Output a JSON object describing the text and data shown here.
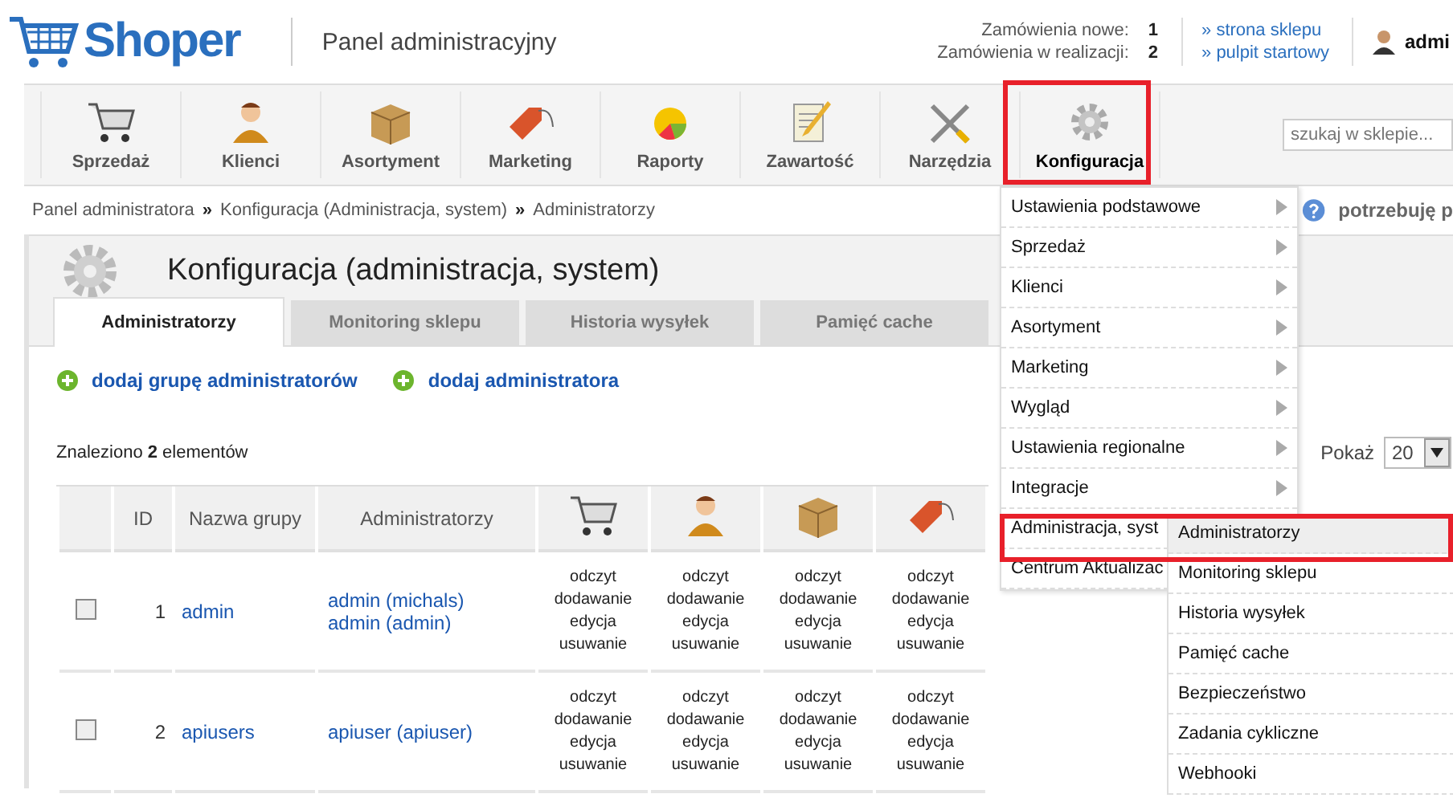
{
  "header": {
    "logo": "Shoper",
    "title": "Panel administracyjny",
    "orders": [
      {
        "label": "Zamówienia nowe:",
        "count": "1"
      },
      {
        "label": "Zamówienia w realizacji:",
        "count": "2"
      }
    ],
    "links": [
      "» strona sklepu",
      "» pulpit startowy"
    ],
    "user": "admi"
  },
  "nav": {
    "items": [
      {
        "label": "Sprzedaż",
        "kind": "cart",
        "selected": false
      },
      {
        "label": "Klienci",
        "kind": "person",
        "selected": false
      },
      {
        "label": "Asortyment",
        "kind": "box",
        "selected": false
      },
      {
        "label": "Marketing",
        "kind": "tag",
        "selected": false
      },
      {
        "label": "Raporty",
        "kind": "pie",
        "selected": false
      },
      {
        "label": "Zawartość",
        "kind": "note",
        "selected": false
      },
      {
        "label": "Narzędzia",
        "kind": "tools",
        "selected": false
      },
      {
        "label": "Konfiguracja",
        "kind": "gear",
        "selected": true
      }
    ],
    "search": {
      "placeholder": "szukaj w sklepie..."
    }
  },
  "breadcrumb": [
    {
      "kind": "link",
      "text": "Panel administratora"
    },
    {
      "kind": "separator",
      "text": "»"
    },
    {
      "kind": "link",
      "text": "Konfiguracja (Administracja, system)"
    },
    {
      "kind": "separator",
      "text": "»"
    },
    {
      "kind": "link",
      "text": "Administratorzy"
    }
  ],
  "help": "potrzebuję p",
  "page": {
    "title": "Konfiguracja (administracja, system)",
    "tabs": [
      {
        "label": "Administratorzy",
        "selected": true
      },
      {
        "label": "Monitoring sklepu",
        "selected": false
      },
      {
        "label": "Historia wysyłek",
        "selected": false
      },
      {
        "label": "Pamięć cache",
        "selected": false
      }
    ],
    "actions": [
      "dodaj grupę administratorów",
      "dodaj administratora"
    ],
    "found": "Znaleziono **2** elementów",
    "page_size": {
      "label": "Pokaż",
      "value": "20"
    },
    "table": {
      "columns": [
        {
          "label": "ID"
        },
        {
          "label": "Nazwa grupy"
        },
        {
          "label": "Administratorzy"
        },
        {
          "kind": "cart"
        },
        {
          "kind": "person"
        },
        {
          "kind": "box"
        },
        {
          "kind": "tag"
        }
      ],
      "rows": [
        {
          "checked": false,
          "id": "1",
          "name": "admin",
          "admins": [
            "admin (michals)",
            "admin (admin)"
          ],
          "perms": [
            [
              "odczyt",
              "dodawanie",
              "edycja",
              "usuwanie"
            ],
            [
              "odczyt",
              "dodawanie",
              "edycja",
              "usuwanie"
            ],
            [
              "odczyt",
              "dodawanie",
              "edycja",
              "usuwanie"
            ],
            [
              "odczyt",
              "dodawanie",
              "edycja",
              "usuwanie"
            ]
          ]
        },
        {
          "checked": false,
          "id": "2",
          "name": "apiusers",
          "admins": [
            "apiuser (apiuser)"
          ],
          "perms": [
            [
              "odczyt",
              "dodawanie",
              "edycja",
              "usuwanie"
            ],
            [
              "odczyt",
              "dodawanie",
              "edycja",
              "usuwanie"
            ],
            [
              "odczyt",
              "dodawanie",
              "edycja",
              "usuwanie"
            ],
            [
              "odczyt",
              "dodawanie",
              "edycja",
              "usuwanie"
            ]
          ]
        }
      ]
    }
  },
  "menu": {
    "items": [
      {
        "label": "Ustawienia podstawowe",
        "arrow": true,
        "highlighted": false
      },
      {
        "label": "Sprzedaż",
        "arrow": true,
        "highlighted": false
      },
      {
        "label": "Klienci",
        "arrow": true,
        "highlighted": false
      },
      {
        "label": "Asortyment",
        "arrow": true,
        "highlighted": false
      },
      {
        "label": "Marketing",
        "arrow": true,
        "highlighted": false
      },
      {
        "label": "Wygląd",
        "arrow": true,
        "highlighted": false
      },
      {
        "label": "Ustawienia regionalne",
        "arrow": true,
        "highlighted": false
      },
      {
        "label": "Integracje",
        "arrow": true,
        "highlighted": false
      },
      {
        "label": "Administracja, syst",
        "arrow": false,
        "highlighted": true
      },
      {
        "label": "Centrum Aktualizac",
        "arrow": false,
        "highlighted": false
      }
    ],
    "submenu": [
      {
        "label": "Administratorzy",
        "selected": true
      },
      {
        "label": "Monitoring sklepu",
        "selected": false
      },
      {
        "label": "Historia wysyłek",
        "selected": false
      },
      {
        "label": "Pamięć cache",
        "selected": false
      },
      {
        "label": "Bezpieczeństwo",
        "selected": false
      },
      {
        "label": "Zadania cykliczne",
        "selected": false
      },
      {
        "label": "Webhooki",
        "selected": false
      }
    ]
  }
}
